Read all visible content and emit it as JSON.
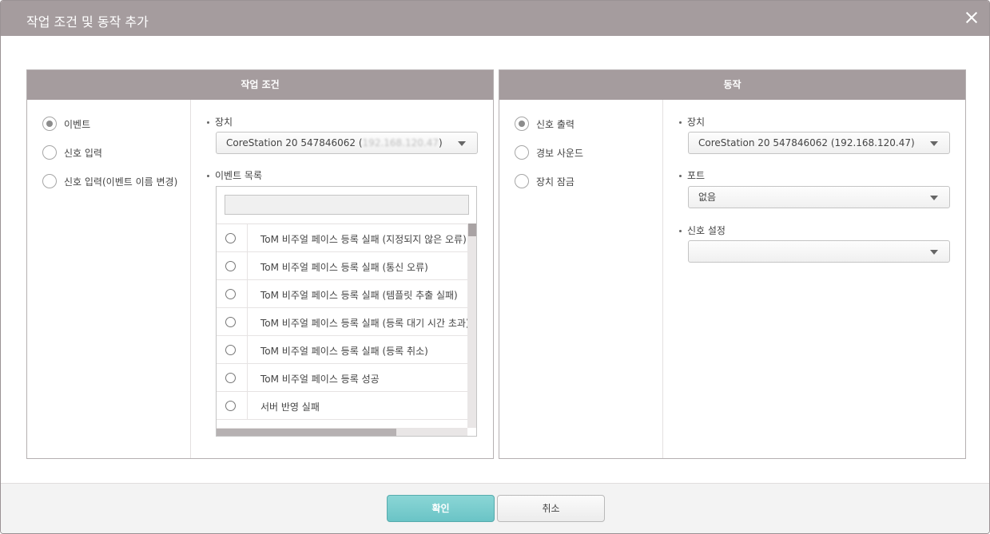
{
  "dialog": {
    "title": "작업 조건 및 동작 추가",
    "close_icon": "close-icon"
  },
  "condition": {
    "header": "작업 조건",
    "types": [
      {
        "label": "이벤트",
        "checked": true
      },
      {
        "label": "신호 입력",
        "checked": false
      },
      {
        "label": "신호 입력(이벤트 이름 변경)",
        "checked": false
      }
    ],
    "device_label": "장치",
    "device_value_prefix": "CoreStation 20 547846062 (",
    "device_value_masked": "192.168.120.47",
    "device_value_suffix": ")",
    "event_list_label": "이벤트 목록",
    "search_value": "",
    "events": [
      "ToM 비주얼 페이스 등록 실패 (지정되지 않은 오류)",
      "ToM 비주얼 페이스 등록 실패 (통신 오류)",
      "ToM 비주얼 페이스 등록 실패 (템플릿 추출 실패)",
      "ToM 비주얼 페이스 등록 실패 (등록 대기 시간 초과)",
      "ToM 비주얼 페이스 등록 실패 (등록 취소)",
      "ToM 비주얼 페이스 등록 성공",
      "서버 반영 실패"
    ]
  },
  "action": {
    "header": "동작",
    "types": [
      {
        "label": "신호 출력",
        "checked": true
      },
      {
        "label": "경보 사운드",
        "checked": false
      },
      {
        "label": "장치 잠금",
        "checked": false
      }
    ],
    "device_label": "장치",
    "device_value": "CoreStation 20 547846062 (192.168.120.47)",
    "port_label": "포트",
    "port_value": "없음",
    "signal_label": "신호 설정",
    "signal_value": ""
  },
  "footer": {
    "ok_label": "확인",
    "cancel_label": "취소"
  }
}
